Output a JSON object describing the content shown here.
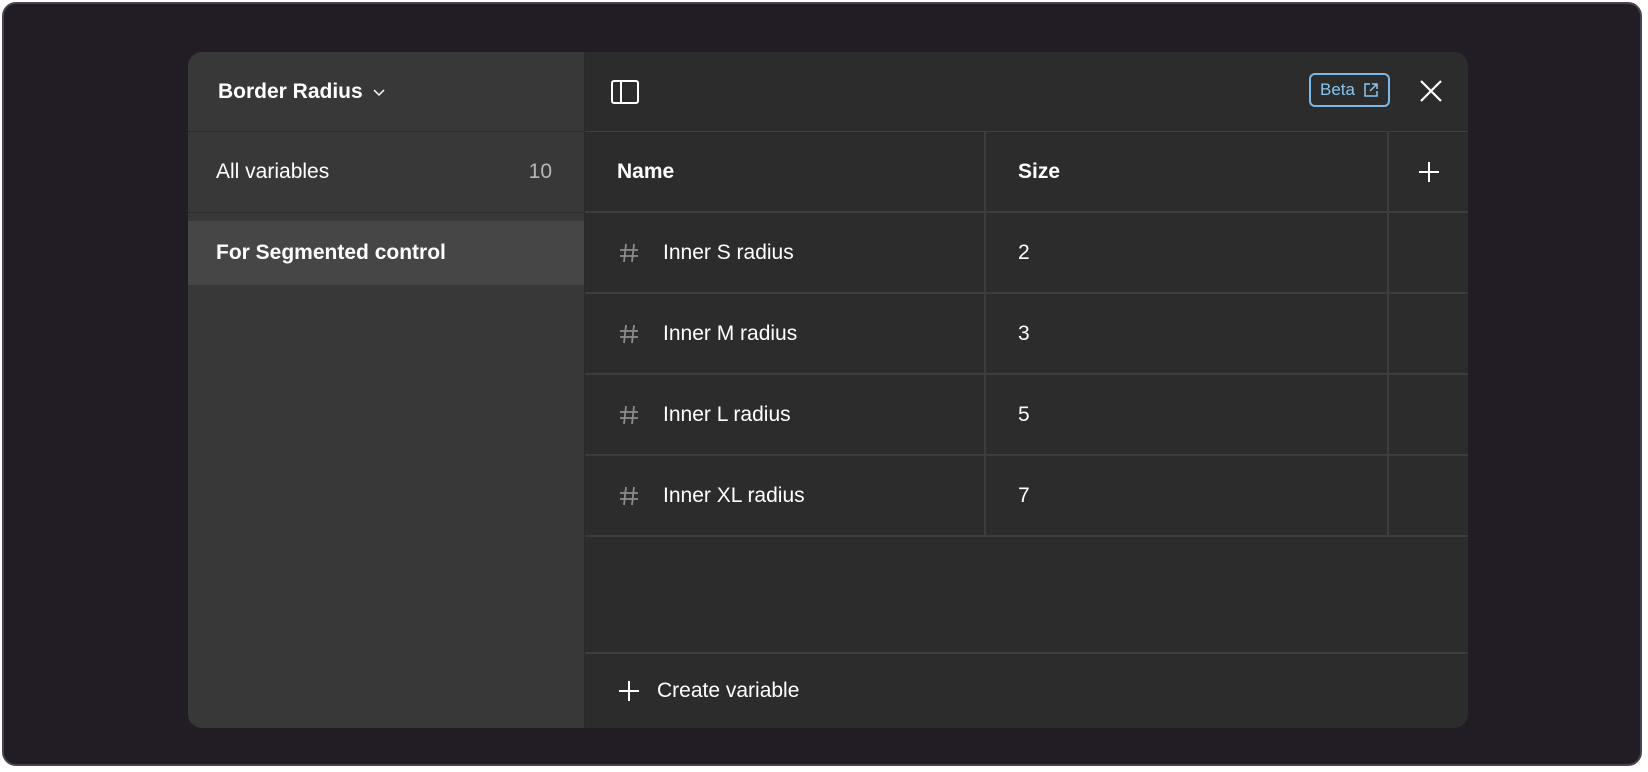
{
  "sidebar": {
    "collection_title": "Border Radius",
    "all_variables_label": "All variables",
    "all_variables_count": "10",
    "groups": [
      {
        "label": "For Segmented control"
      }
    ]
  },
  "topbar": {
    "beta_label": "Beta"
  },
  "table": {
    "columns": {
      "name": "Name",
      "size": "Size"
    },
    "rows": [
      {
        "name": "Inner S radius",
        "value": "2"
      },
      {
        "name": "Inner M radius",
        "value": "3"
      },
      {
        "name": "Inner L radius",
        "value": "5"
      },
      {
        "name": "Inner XL radius",
        "value": "7"
      }
    ]
  },
  "footer": {
    "create_label": "Create variable"
  },
  "colors": {
    "backdrop": "#221c24",
    "sidebar": "#383838",
    "main": "#2c2c2c",
    "selected": "#464646",
    "accent": "#79b8e8"
  },
  "icons": [
    "chevron-down-icon",
    "sidebar-toggle-icon",
    "external-link-icon",
    "close-icon",
    "plus-icon",
    "hash-icon"
  ]
}
